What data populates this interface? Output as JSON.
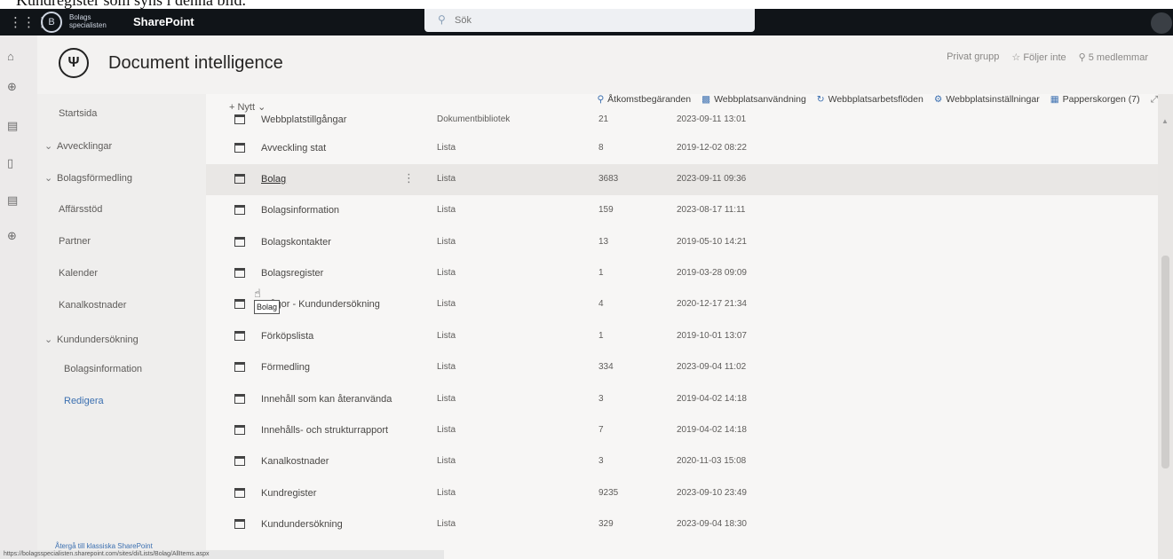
{
  "caption": "Kundregister som syns i denna bild.",
  "suitebar": {
    "org_name": "Bolags\nspecialisten",
    "app_name": "SharePoint",
    "search_placeholder": "Sök"
  },
  "site": {
    "title": "Document intelligence",
    "group_type": "Privat grupp",
    "follow_label": "Följer inte",
    "members_label": "5 medlemmar"
  },
  "leftnav": {
    "items": [
      {
        "label": "Startsida",
        "chevron": false
      },
      {
        "label": "Avvecklingar",
        "chevron": true
      },
      {
        "label": "Bolagsförmedling",
        "chevron": true
      },
      {
        "label": "Affärsstöd",
        "chevron": false
      },
      {
        "label": "Partner",
        "chevron": false
      },
      {
        "label": "Kalender",
        "chevron": false
      },
      {
        "label": "Kanalkostnader",
        "chevron": false
      },
      {
        "label": "Kundundersökning",
        "chevron": true
      },
      {
        "label": "Bolagsinformation",
        "chevron": false
      },
      {
        "label": "Redigera",
        "chevron": false
      }
    ],
    "classic_link": "Återgå till klassiska SharePoint",
    "status_url": "https://bolagsspecialisten.sharepoint.com/sites/di/Lists/Bolag/AllItems.aspx"
  },
  "commandbar": {
    "new_label": "Nytt",
    "actions": [
      {
        "label": "Åtkomstbegäranden",
        "icon": "person-key-icon"
      },
      {
        "label": "Webbplatsanvändning",
        "icon": "chart-icon"
      },
      {
        "label": "Webbplatsarbetsflöden",
        "icon": "refresh-icon"
      },
      {
        "label": "Webbplatsinställningar",
        "icon": "gear-icon"
      },
      {
        "label": "Papperskorgen (7)",
        "icon": "trash-icon"
      }
    ]
  },
  "rows": [
    {
      "name": "Webbplatstillgångar",
      "type": "Dokumentbibliotek",
      "count": "21",
      "modified": "2023-09-11 13:01"
    },
    {
      "name": "Avveckling stat",
      "type": "Lista",
      "count": "8",
      "modified": "2019-12-02 08:22"
    },
    {
      "name": "Bolag",
      "type": "Lista",
      "count": "3683",
      "modified": "2023-09-11 09:36"
    },
    {
      "name": "Bolagsinformation",
      "type": "Lista",
      "count": "159",
      "modified": "2023-08-17 11:11"
    },
    {
      "name": "Bolagskontakter",
      "type": "Lista",
      "count": "13",
      "modified": "2019-05-10 14:21"
    },
    {
      "name": "Bolagsregister",
      "type": "Lista",
      "count": "1",
      "modified": "2019-03-28 09:09"
    },
    {
      "name": "Frågor - Kundundersökning",
      "type": "Lista",
      "count": "4",
      "modified": "2020-12-17 21:34"
    },
    {
      "name": "Förköpslista",
      "type": "Lista",
      "count": "1",
      "modified": "2019-10-01 13:07"
    },
    {
      "name": "Förmedling",
      "type": "Lista",
      "count": "334",
      "modified": "2023-09-04 11:02"
    },
    {
      "name": "Innehåll som kan återanvända",
      "type": "Lista",
      "count": "3",
      "modified": "2019-04-02 14:18"
    },
    {
      "name": "Innehålls- och strukturrapport",
      "type": "Lista",
      "count": "7",
      "modified": "2019-04-02 14:18"
    },
    {
      "name": "Kanalkostnader",
      "type": "Lista",
      "count": "3",
      "modified": "2020-11-03 15:08"
    },
    {
      "name": "Kundregister",
      "type": "Lista",
      "count": "9235",
      "modified": "2023-09-10 23:49"
    },
    {
      "name": "Kundundersökning",
      "type": "Lista",
      "count": "329",
      "modified": "2023-09-04 18:30"
    }
  ],
  "tooltip": "Bolag"
}
